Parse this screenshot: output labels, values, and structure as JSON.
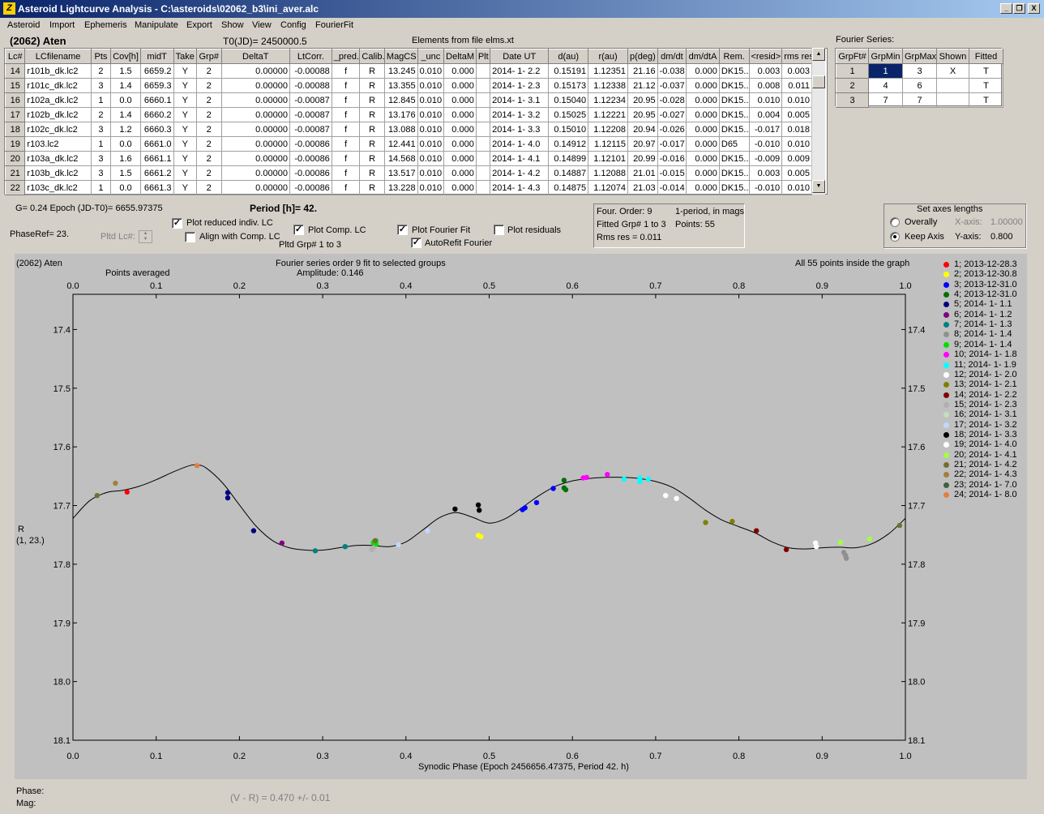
{
  "window": {
    "title": "Asteroid Lightcurve Analysis - C:\\asteroids\\02062_b3\\ini_aver.alc",
    "icon_letter": "Z",
    "minimize": "_",
    "restore": "❐",
    "close": "X"
  },
  "menu": [
    "Asteroid",
    "Import",
    "Ephemeris",
    "Manipulate",
    "Export",
    "Show",
    "View",
    "Config",
    "FourierFit"
  ],
  "header": {
    "asteroid": "(2062) Aten",
    "t0": "T0(JD)= 2450000.5",
    "elements": "Elements from file elms.xt"
  },
  "table": {
    "columns": [
      "Lc#",
      "LCfilename",
      "Pts",
      "Cov[h]",
      "midT",
      "Take",
      "Grp#",
      "DeltaT",
      "LtCorr.",
      "_pred.",
      "Calib.",
      "MagCS",
      "_unc",
      "DeltaM",
      "Plt",
      "Date UT",
      "d(au)",
      "r(au)",
      "p(deg)",
      "dm/dt",
      "dm/dtA",
      "Rem.",
      "<resid>",
      "rms res"
    ],
    "rows": [
      [
        "14",
        "r101b_dk.lc2",
        "2",
        "1.5",
        "6659.2",
        "Y",
        "2",
        "0.00000",
        "-0.00088",
        "f",
        "R",
        "13.245",
        "0.010",
        "0.000",
        "",
        "2014- 1- 2.2",
        "0.15191",
        "1.12351",
        "21.16",
        "-0.038",
        "0.000",
        "DK15..",
        "0.003",
        "0.003"
      ],
      [
        "15",
        "r101c_dk.lc2",
        "3",
        "1.4",
        "6659.3",
        "Y",
        "2",
        "0.00000",
        "-0.00088",
        "f",
        "R",
        "13.355",
        "0.010",
        "0.000",
        "",
        "2014- 1- 2.3",
        "0.15173",
        "1.12338",
        "21.12",
        "-0.037",
        "0.000",
        "DK15..",
        "0.008",
        "0.011"
      ],
      [
        "16",
        "r102a_dk.lc2",
        "1",
        "0.0",
        "6660.1",
        "Y",
        "2",
        "0.00000",
        "-0.00087",
        "f",
        "R",
        "12.845",
        "0.010",
        "0.000",
        "",
        "2014- 1- 3.1",
        "0.15040",
        "1.12234",
        "20.95",
        "-0.028",
        "0.000",
        "DK15..",
        "0.010",
        "0.010"
      ],
      [
        "17",
        "r102b_dk.lc2",
        "2",
        "1.4",
        "6660.2",
        "Y",
        "2",
        "0.00000",
        "-0.00087",
        "f",
        "R",
        "13.176",
        "0.010",
        "0.000",
        "",
        "2014- 1- 3.2",
        "0.15025",
        "1.12221",
        "20.95",
        "-0.027",
        "0.000",
        "DK15..",
        "0.004",
        "0.005"
      ],
      [
        "18",
        "r102c_dk.lc2",
        "3",
        "1.2",
        "6660.3",
        "Y",
        "2",
        "0.00000",
        "-0.00087",
        "f",
        "R",
        "13.088",
        "0.010",
        "0.000",
        "",
        "2014- 1- 3.3",
        "0.15010",
        "1.12208",
        "20.94",
        "-0.026",
        "0.000",
        "DK15..",
        "-0.017",
        "0.018"
      ],
      [
        "19",
        "r103.lc2",
        "1",
        "0.0",
        "6661.0",
        "Y",
        "2",
        "0.00000",
        "-0.00086",
        "f",
        "R",
        "12.441",
        "0.010",
        "0.000",
        "",
        "2014- 1- 4.0",
        "0.14912",
        "1.12115",
        "20.97",
        "-0.017",
        "0.000",
        "D65",
        "-0.010",
        "0.010"
      ],
      [
        "20",
        "r103a_dk.lc2",
        "3",
        "1.6",
        "6661.1",
        "Y",
        "2",
        "0.00000",
        "-0.00086",
        "f",
        "R",
        "14.568",
        "0.010",
        "0.000",
        "",
        "2014- 1- 4.1",
        "0.14899",
        "1.12101",
        "20.99",
        "-0.016",
        "0.000",
        "DK15..",
        "-0.009",
        "0.009"
      ],
      [
        "21",
        "r103b_dk.lc2",
        "3",
        "1.5",
        "6661.2",
        "Y",
        "2",
        "0.00000",
        "-0.00086",
        "f",
        "R",
        "13.517",
        "0.010",
        "0.000",
        "",
        "2014- 1- 4.2",
        "0.14887",
        "1.12088",
        "21.01",
        "-0.015",
        "0.000",
        "DK15..",
        "0.003",
        "0.005"
      ],
      [
        "22",
        "r103c_dk.lc2",
        "1",
        "0.0",
        "6661.3",
        "Y",
        "2",
        "0.00000",
        "-0.00086",
        "f",
        "R",
        "13.228",
        "0.010",
        "0.000",
        "",
        "2014- 1- 4.3",
        "0.14875",
        "1.12074",
        "21.03",
        "-0.014",
        "0.000",
        "DK15..",
        "-0.010",
        "0.010"
      ]
    ]
  },
  "fourier": {
    "label": "Fourier Series:",
    "columns": [
      "GrpFt#",
      "GrpMin",
      "GrpMax",
      "Shown",
      "Fitted"
    ],
    "rows": [
      [
        "1",
        "1",
        "3",
        "X",
        "T"
      ],
      [
        "2",
        "4",
        "6",
        "",
        "T"
      ],
      [
        "3",
        "7",
        "7",
        "",
        "T"
      ]
    ]
  },
  "controls": {
    "g_epoch": "G= 0.24    Epoch (JD-T0)= 6655.97375",
    "period": "Period [h]= 42.",
    "phaseref": "PhaseRef= 23.",
    "pltd_lc": "Pltd Lc#:",
    "plot_reduced": "Plot reduced indiv. LC",
    "align_comp": "Align with Comp. LC",
    "plot_comp": "Plot Comp. LC",
    "pltd_grp": "Pltd Grp#  1   to   3",
    "plot_fourier": "Plot Fourier Fit",
    "autorefit": "AutoRefit Fourier",
    "plot_residuals": "Plot residuals",
    "info_order": "Four. Order:  9",
    "info_period": "1-period,  in mags",
    "info_fitted": "Fitted Grp# 1 to 3",
    "info_points": "Points: 55",
    "info_rms": "Rms res     = 0.011",
    "axes_title": "Set axes lengths",
    "overally": "Overally",
    "keep_axis": "Keep Axis",
    "xaxis_label": "X-axis:",
    "xaxis_value": "1.00000",
    "yaxis_label": "Y-axis:",
    "yaxis_value": "0.800",
    "check_mark": "✓"
  },
  "plot": {
    "title_left": "(2062) Aten",
    "points_averaged": "Points averaged",
    "title_center": "Fourier series order 9 fit to selected groups",
    "amplitude": "Amplitude: 0.146",
    "title_right": "All 55 points inside the graph",
    "ylabel_line1": "R",
    "ylabel_line2": "(1, 23.)",
    "xlabel": "Synodic Phase (Epoch 2456656.47375, Period 42. h)"
  },
  "chart_data": {
    "type": "scatter",
    "title": "Fourier series order 9 fit to selected groups",
    "xlabel": "Synodic Phase (Epoch 2456656.47375, Period 42. h)",
    "ylabel": "R (1, 23.)",
    "xlim": [
      0.0,
      1.0
    ],
    "ylim": [
      18.1,
      17.34
    ],
    "y_inverted": true,
    "x_ticks": [
      "0.0",
      "0.1",
      "0.2",
      "0.3",
      "0.4",
      "0.5",
      "0.6",
      "0.7",
      "0.8",
      "0.9",
      "1.0"
    ],
    "y_ticks": [
      "17.4",
      "17.5",
      "17.6",
      "17.7",
      "17.8",
      "17.9",
      "18.0",
      "18.1"
    ],
    "grid": false,
    "legend_position": "right",
    "series": [
      {
        "name": "1; 2013-12-28.3",
        "color": "#ff0000",
        "points": [
          [
            0.065,
            17.677
          ]
        ]
      },
      {
        "name": "2; 2013-12-30.8",
        "color": "#ffff00",
        "points": [
          [
            0.487,
            17.751
          ],
          [
            0.49,
            17.753
          ]
        ]
      },
      {
        "name": "3; 2013-12-31.0",
        "color": "#0000ff",
        "points": [
          [
            0.54,
            17.707
          ],
          [
            0.543,
            17.704
          ],
          [
            0.557,
            17.695
          ],
          [
            0.577,
            17.671
          ]
        ]
      },
      {
        "name": "4; 2013-12-31.0",
        "color": "#007000",
        "points": [
          [
            0.59,
            17.67
          ],
          [
            0.59,
            17.657
          ],
          [
            0.592,
            17.673
          ]
        ]
      },
      {
        "name": "5; 2014- 1- 1.1",
        "color": "#000080",
        "points": [
          [
            0.186,
            17.678
          ],
          [
            0.186,
            17.687
          ],
          [
            0.217,
            17.743
          ]
        ]
      },
      {
        "name": "6; 2014- 1- 1.2",
        "color": "#800080",
        "points": [
          [
            0.251,
            17.764
          ]
        ]
      },
      {
        "name": "7; 2014- 1- 1.3",
        "color": "#008080",
        "points": [
          [
            0.291,
            17.777
          ],
          [
            0.327,
            17.77
          ]
        ]
      },
      {
        "name": "8; 2014- 1- 1.4",
        "color": "#909090",
        "points": [
          [
            0.926,
            17.78
          ],
          [
            0.928,
            17.785
          ],
          [
            0.929,
            17.79
          ]
        ]
      },
      {
        "name": "9; 2014- 1- 1.4",
        "color": "#00e000",
        "points": [
          [
            0.361,
            17.763
          ],
          [
            0.364,
            17.76
          ],
          [
            0.364,
            17.766
          ]
        ]
      },
      {
        "name": "10; 2014- 1- 1.8",
        "color": "#ff00ff",
        "points": [
          [
            0.613,
            17.653
          ],
          [
            0.617,
            17.652
          ],
          [
            0.642,
            17.647
          ]
        ]
      },
      {
        "name": "11; 2014- 1- 1.9",
        "color": "#00ffff",
        "points": [
          [
            0.662,
            17.655
          ],
          [
            0.681,
            17.653
          ],
          [
            0.681,
            17.659
          ],
          [
            0.691,
            17.655
          ]
        ]
      },
      {
        "name": "12; 2014- 1- 2.0",
        "color": "#ffffff",
        "points": [
          [
            0.712,
            17.683
          ],
          [
            0.725,
            17.688
          ],
          [
            0.892,
            17.764
          ],
          [
            0.893,
            17.77
          ]
        ]
      },
      {
        "name": "13; 2014- 1- 2.1",
        "color": "#808000",
        "points": [
          [
            0.76,
            17.729
          ],
          [
            0.792,
            17.727
          ]
        ]
      },
      {
        "name": "14; 2014- 1- 2.2",
        "color": "#800000",
        "points": [
          [
            0.821,
            17.743
          ],
          [
            0.857,
            17.775
          ]
        ]
      },
      {
        "name": "15; 2014- 1- 2.3",
        "color": "#b0b0b0",
        "points": [
          [
            0.359,
            17.775
          ],
          [
            0.361,
            17.772
          ]
        ]
      },
      {
        "name": "16; 2014- 1- 3.1",
        "color": "#c0e0c0",
        "points": []
      },
      {
        "name": "17; 2014- 1- 3.2",
        "color": "#c0d8ff",
        "points": [
          [
            0.391,
            17.767
          ],
          [
            0.426,
            17.743
          ]
        ]
      },
      {
        "name": "18; 2014- 1- 3.3",
        "color": "#000000",
        "points": [
          [
            0.459,
            17.706
          ],
          [
            0.487,
            17.699
          ],
          [
            0.488,
            17.708
          ]
        ]
      },
      {
        "name": "19; 2014- 1- 4.0",
        "color": "#ffffff",
        "points": []
      },
      {
        "name": "20; 2014- 1- 4.1",
        "color": "#a0ff40",
        "points": [
          [
            0.922,
            17.763
          ],
          [
            0.957,
            17.757
          ]
        ]
      },
      {
        "name": "21; 2014- 1- 4.2",
        "color": "#707030",
        "points": [
          [
            0.029,
            17.683
          ],
          [
            0.363,
            17.76
          ],
          [
            0.993,
            17.734
          ]
        ]
      },
      {
        "name": "22; 2014- 1- 4.3",
        "color": "#a08040",
        "points": [
          [
            0.051,
            17.662
          ]
        ]
      },
      {
        "name": "23; 2014- 1- 7.0",
        "color": "#406040",
        "points": []
      },
      {
        "name": "24; 2014- 1- 8.0",
        "color": "#e08040",
        "points": [
          [
            0.149,
            17.632
          ]
        ]
      }
    ],
    "fit_curve": {
      "x": [
        0.0,
        0.02,
        0.04,
        0.06,
        0.08,
        0.1,
        0.12,
        0.14,
        0.15,
        0.16,
        0.18,
        0.2,
        0.22,
        0.24,
        0.26,
        0.28,
        0.3,
        0.32,
        0.34,
        0.36,
        0.38,
        0.4,
        0.42,
        0.44,
        0.46,
        0.48,
        0.5,
        0.52,
        0.54,
        0.56,
        0.58,
        0.6,
        0.62,
        0.64,
        0.66,
        0.68,
        0.7,
        0.72,
        0.74,
        0.76,
        0.78,
        0.8,
        0.82,
        0.84,
        0.86,
        0.88,
        0.9,
        0.92,
        0.94,
        0.96,
        0.98,
        1.0
      ],
      "y": [
        17.722,
        17.692,
        17.678,
        17.674,
        17.667,
        17.656,
        17.643,
        17.632,
        17.631,
        17.636,
        17.662,
        17.699,
        17.735,
        17.76,
        17.772,
        17.776,
        17.776,
        17.772,
        17.768,
        17.768,
        17.77,
        17.762,
        17.742,
        17.721,
        17.712,
        17.72,
        17.73,
        17.722,
        17.703,
        17.683,
        17.667,
        17.658,
        17.654,
        17.652,
        17.652,
        17.654,
        17.659,
        17.669,
        17.687,
        17.708,
        17.725,
        17.736,
        17.747,
        17.762,
        17.772,
        17.774,
        17.772,
        17.771,
        17.772,
        17.765,
        17.748,
        17.722
      ]
    }
  },
  "status": {
    "phase": "Phase:",
    "mag": "Mag:",
    "color_index": "(V - R) = 0.470 +/- 0.01"
  }
}
